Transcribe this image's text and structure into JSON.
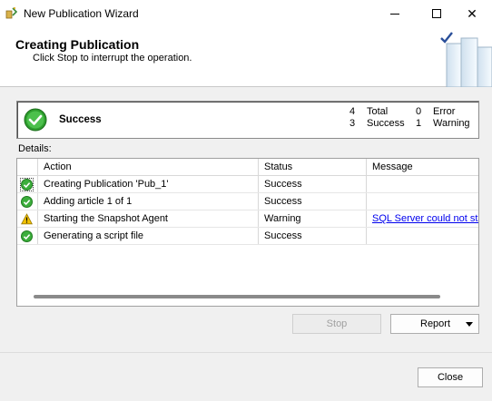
{
  "window": {
    "title": "New Publication Wizard",
    "minimize_label": "",
    "maximize_label": "",
    "close_glyph": "✕"
  },
  "header": {
    "title": "Creating Publication",
    "subtitle": "Click Stop to interrupt the operation."
  },
  "summary": {
    "status": "Success",
    "total_count": "4",
    "total_label": "Total",
    "success_count": "3",
    "success_label": "Success",
    "error_count": "0",
    "error_label": "Error",
    "warning_count": "1",
    "warning_label": "Warning"
  },
  "details": {
    "label": "Details:",
    "columns": [
      "Action",
      "Status",
      "Message"
    ],
    "rows": [
      {
        "icon": "success-icon",
        "action": "Creating Publication 'Pub_1'",
        "status": "Success",
        "message": ""
      },
      {
        "icon": "success-icon",
        "action": "Adding article 1 of 1",
        "status": "Success",
        "message": ""
      },
      {
        "icon": "warning-icon",
        "action": "Starting the Snapshot Agent",
        "status": "Warning",
        "message": "SQL Server could not sta"
      },
      {
        "icon": "success-icon",
        "action": "Generating a script file",
        "status": "Success",
        "message": ""
      }
    ]
  },
  "buttons": {
    "stop": "Stop",
    "report": "Report",
    "close": "Close"
  },
  "colors": {
    "success": "#2e9e2e",
    "warning": "#f2c200",
    "link": "#0000ee"
  }
}
